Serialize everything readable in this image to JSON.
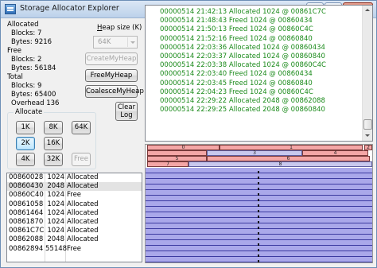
{
  "window": {
    "title": "Storage Allocator Explorer"
  },
  "stats": {
    "allocated_label": "Allocated",
    "allocated_blocks": "Blocks: 7",
    "allocated_bytes": "Bytes: 9216",
    "free_label": "Free",
    "free_blocks": "Blocks: 2",
    "free_bytes": "Bytes: 56184",
    "total_label": "Total",
    "total_blocks": "Blocks: 9",
    "total_bytes": "Bytes: 65400",
    "overhead": "Overhead 136"
  },
  "heap": {
    "label_prefix": "",
    "label_underlined": "H",
    "label_rest": "eap size (K)",
    "size_value": "64K",
    "create_label": "CreateMyHeap",
    "free_label": "FreeMyHeap",
    "coalesce_label": "CoalesceMyHeap",
    "clear_label_1": "Clear",
    "clear_label_2": "Log"
  },
  "allocate": {
    "title": "Allocate",
    "buttons": [
      "1K",
      "8K",
      "64K",
      "2K",
      "16K",
      "4K",
      "32K",
      "Free"
    ],
    "selected": "2K"
  },
  "log": [
    "00000514  21:42:13  Allocated 1024 @ 00861C7C",
    "00000514  21:48:43  Freed 1024 @ 00860434",
    "00000514  21:50:13  Freed 1024 @ 00860C4C",
    "00000514  21:52:16  Freed 1024 @ 00860840",
    "00000514  22:03:36  Allocated 1024 @ 00860434",
    "00000514  22:03:37  Allocated 1024 @ 00860840",
    "00000514  22:03:38  Allocated 1024 @ 00860C4C",
    "00000514  22:03:40  Freed 1024 @ 00860434",
    "00000514  22:03:45  Freed 1024 @ 00860840",
    "00000514  22:04:23  Freed 1024 @ 00860C4C",
    "00000514  22:29:22  Allocated 2048 @ 00862088",
    "00000514  22:29:25  Allocated 2048 @ 00860840"
  ],
  "blocks": [
    {
      "addr": "00860028",
      "size": "1024",
      "status": "Allocated"
    },
    {
      "addr": "00860430",
      "size": "2048",
      "status": "Allocated"
    },
    {
      "addr": "00860C40",
      "size": "1024",
      "status": "Free"
    },
    {
      "addr": "00861058",
      "size": "1024",
      "status": "Allocated"
    },
    {
      "addr": "00861464",
      "size": "1024",
      "status": "Allocated"
    },
    {
      "addr": "00861870",
      "size": "1024",
      "status": "Allocated"
    },
    {
      "addr": "00861C7C",
      "size": "1024",
      "status": "Allocated"
    },
    {
      "addr": "00862088",
      "size": "2048",
      "status": "Allocated"
    },
    {
      "addr": "00862894",
      "size": "55148",
      "status": "Free"
    }
  ],
  "heapmap": {
    "labels": [
      "0",
      "1",
      "2",
      "3",
      "4",
      "5",
      "6",
      "7",
      "8"
    ],
    "alloc_color": "#f4a6a6",
    "free_color": "#aaa8ea"
  }
}
